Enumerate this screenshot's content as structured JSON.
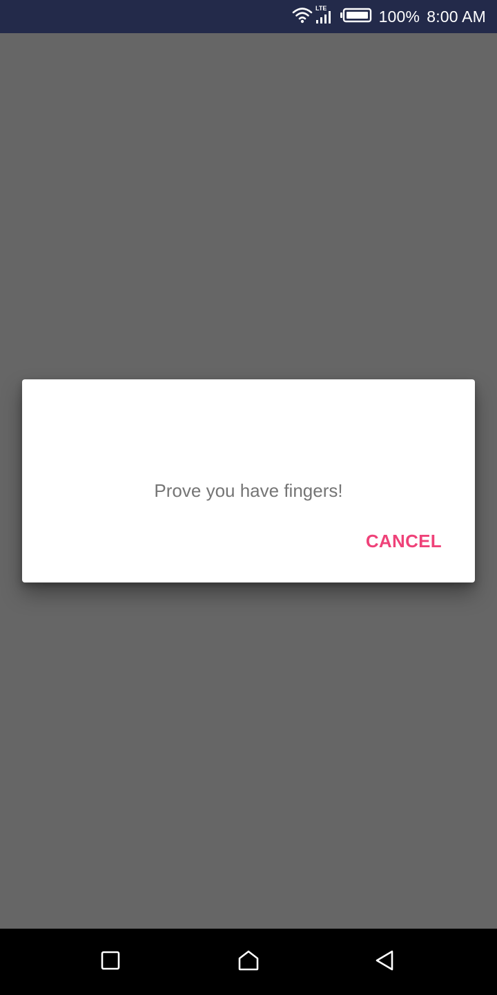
{
  "status_bar": {
    "network_label": "LTE",
    "battery_percent": "100%",
    "time": "8:00 AM",
    "icons": [
      "wifi-icon",
      "cellular-signal-icon",
      "battery-icon"
    ]
  },
  "dialog": {
    "message": "Prove you have fingers!",
    "cancel_label": "CANCEL"
  },
  "navigation_bar": {
    "buttons": [
      "recents-icon",
      "home-icon",
      "back-icon"
    ]
  },
  "colors": {
    "status_bar_bg": "#232a4a",
    "scrim": "#666666",
    "accent": "#ef4279",
    "message_text": "#757575"
  }
}
